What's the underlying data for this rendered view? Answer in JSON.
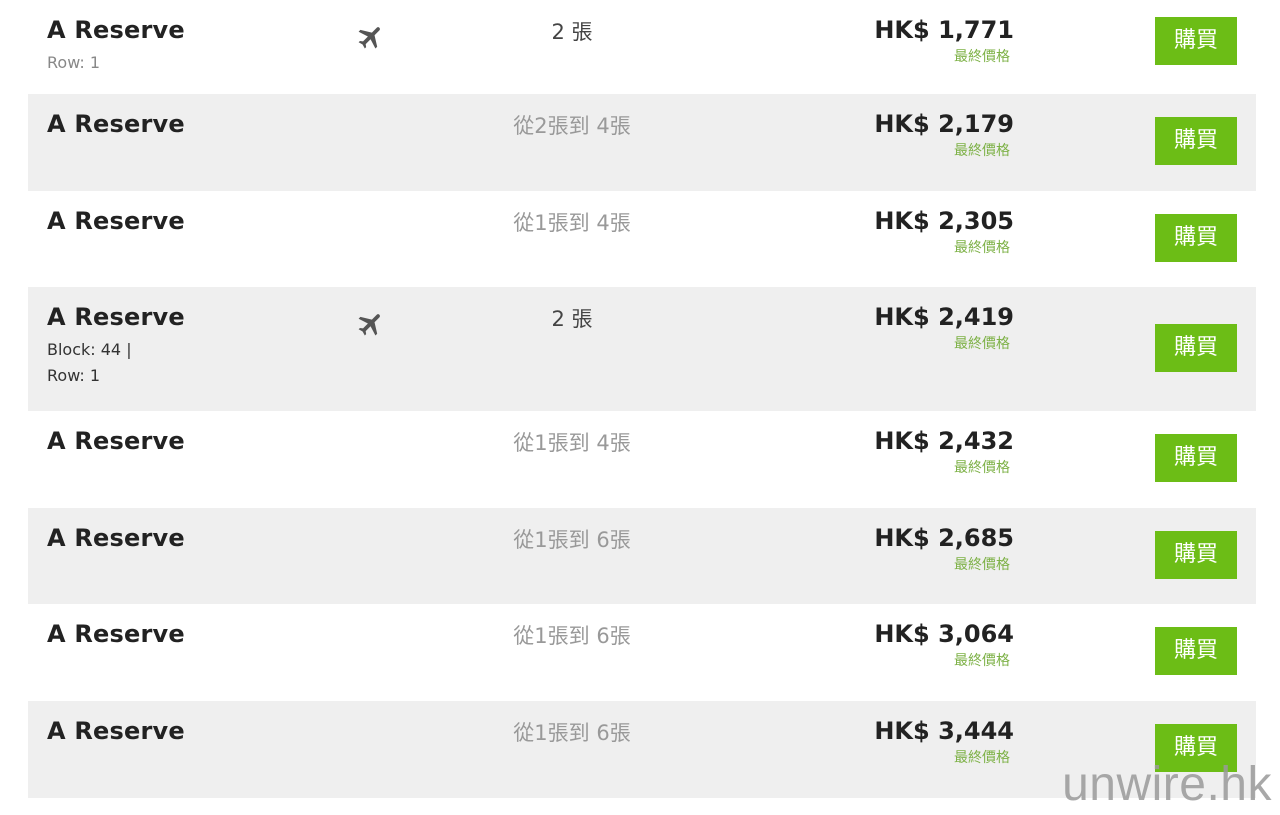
{
  "colors": {
    "buy_button": "#6cbd16",
    "final_price_text": "#7db146",
    "alt_row_background": "#efefef",
    "watermark": "#9a9a9a"
  },
  "listings": [
    {
      "section": "A Reserve",
      "details": [
        "Row: 1"
      ],
      "details_style": "muted",
      "icon": "airplane-icon",
      "quantity": "2 張",
      "quantity_style": "dark",
      "price": "HK$ 1,771",
      "price_note": "最終價格",
      "buy_label": "購買"
    },
    {
      "section": "A Reserve",
      "details": [],
      "icon": null,
      "quantity": "從2張到 4張",
      "price": "HK$ 2,179",
      "price_note": "最終價格",
      "buy_label": "購買"
    },
    {
      "section": "A Reserve",
      "details": [],
      "icon": null,
      "quantity": "從1張到 4張",
      "price": "HK$ 2,305",
      "price_note": "最終價格",
      "buy_label": "購買"
    },
    {
      "section": "A Reserve",
      "details": [
        "Block: 44 |",
        "Row: 1"
      ],
      "details_style": "dark",
      "icon": "airplane-icon",
      "quantity": "2 張",
      "quantity_style": "dark",
      "price": "HK$ 2,419",
      "price_note": "最終價格",
      "buy_label": "購買"
    },
    {
      "section": "A Reserve",
      "details": [],
      "icon": null,
      "quantity": "從1張到 4張",
      "price": "HK$ 2,432",
      "price_note": "最終價格",
      "buy_label": "購買"
    },
    {
      "section": "A Reserve",
      "details": [],
      "icon": null,
      "quantity": "從1張到 6張",
      "price": "HK$ 2,685",
      "price_note": "最終價格",
      "buy_label": "購買"
    },
    {
      "section": "A Reserve",
      "details": [],
      "icon": null,
      "quantity": "從1張到 6張",
      "price": "HK$ 3,064",
      "price_note": "最終價格",
      "buy_label": "購買"
    },
    {
      "section": "A Reserve",
      "details": [],
      "icon": null,
      "quantity": "從1張到 6張",
      "price": "HK$ 3,444",
      "price_note": "最終價格",
      "buy_label": "購買"
    }
  ],
  "watermark": "unwire.hk"
}
